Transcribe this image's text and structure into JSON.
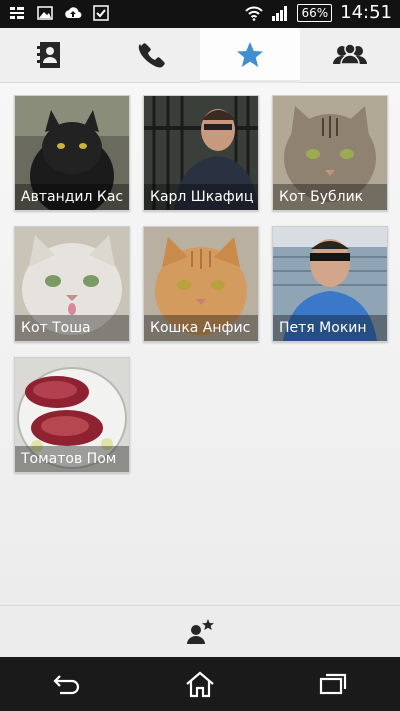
{
  "status_bar": {
    "battery": "66%",
    "time": "14:51"
  },
  "tabs": [
    {
      "name": "contacts",
      "icon": "address-book-icon"
    },
    {
      "name": "phone",
      "icon": "phone-icon"
    },
    {
      "name": "favorites",
      "icon": "star-icon",
      "active": true
    },
    {
      "name": "groups",
      "icon": "groups-icon"
    }
  ],
  "favorites": [
    {
      "name": "Автандил Кас"
    },
    {
      "name": "Карл Шкафиц"
    },
    {
      "name": "Кот Бублик"
    },
    {
      "name": "Кот Тоша"
    },
    {
      "name": "Кошка Анфис"
    },
    {
      "name": "Петя Мокин"
    },
    {
      "name": "Томатов Пом"
    }
  ],
  "colors": {
    "accent": "#3f8fd2",
    "status_bar": "#121212",
    "nav_bar": "#1a1a1a"
  }
}
